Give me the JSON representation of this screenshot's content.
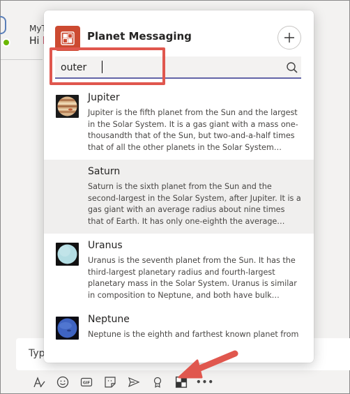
{
  "background": {
    "chat_name": "MyT",
    "chat_message_prefix": "Hi",
    "compose_placeholder": "Typ"
  },
  "popup": {
    "title": "Planet Messaging",
    "search": {
      "value": "outer",
      "placeholder": "Search"
    },
    "results": [
      {
        "title": "Jupiter",
        "description": "Jupiter is the fifth planet from the Sun and the largest in the Solar System. It is a gas giant with a mass one-thousandth that of the Sun, but two-and-a-half times that of all the other planets in the Solar System…",
        "icon": "jupiter-thumbnail"
      },
      {
        "title": "Saturn",
        "description": "Saturn is the sixth planet from the Sun and the second-largest in the Solar System, after Jupiter. It is a gas giant with an average radius about nine times that of Earth. It has only one-eighth the average…",
        "icon": "none",
        "selected": true
      },
      {
        "title": "Uranus",
        "description": "Uranus is the seventh planet from the Sun. It has the third-largest planetary radius and fourth-largest planetary mass in the Solar System. Uranus is similar in composition to Neptune, and both have bulk…",
        "icon": "uranus-thumbnail"
      },
      {
        "title": "Neptune",
        "description": "Neptune is the eighth and farthest known planet from",
        "icon": "neptune-thumbnail"
      }
    ]
  },
  "toolbar": {
    "icons": [
      "format-icon",
      "emoji-icon",
      "gif-icon",
      "sticker-icon",
      "send-icon",
      "praise-icon",
      "planet-messaging-app-icon",
      "more-options-icon"
    ],
    "gif_label": "GIF",
    "more_label": "•••"
  },
  "colors": {
    "app_accent": "#cc4a31",
    "search_underline": "#6264a7",
    "annotation_red": "#e0574e",
    "presence_green": "#6bb700"
  }
}
